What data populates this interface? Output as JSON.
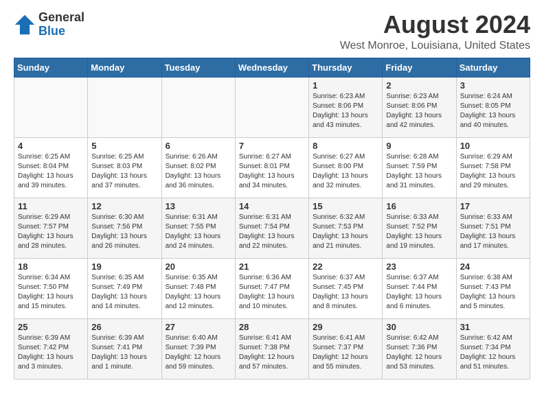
{
  "header": {
    "logo_line1": "General",
    "logo_line2": "Blue",
    "main_title": "August 2024",
    "subtitle": "West Monroe, Louisiana, United States"
  },
  "calendar": {
    "days_of_week": [
      "Sunday",
      "Monday",
      "Tuesday",
      "Wednesday",
      "Thursday",
      "Friday",
      "Saturday"
    ],
    "weeks": [
      [
        {
          "day": "",
          "info": ""
        },
        {
          "day": "",
          "info": ""
        },
        {
          "day": "",
          "info": ""
        },
        {
          "day": "",
          "info": ""
        },
        {
          "day": "1",
          "info": "Sunrise: 6:23 AM\nSunset: 8:06 PM\nDaylight: 13 hours\nand 43 minutes."
        },
        {
          "day": "2",
          "info": "Sunrise: 6:23 AM\nSunset: 8:06 PM\nDaylight: 13 hours\nand 42 minutes."
        },
        {
          "day": "3",
          "info": "Sunrise: 6:24 AM\nSunset: 8:05 PM\nDaylight: 13 hours\nand 40 minutes."
        }
      ],
      [
        {
          "day": "4",
          "info": "Sunrise: 6:25 AM\nSunset: 8:04 PM\nDaylight: 13 hours\nand 39 minutes."
        },
        {
          "day": "5",
          "info": "Sunrise: 6:25 AM\nSunset: 8:03 PM\nDaylight: 13 hours\nand 37 minutes."
        },
        {
          "day": "6",
          "info": "Sunrise: 6:26 AM\nSunset: 8:02 PM\nDaylight: 13 hours\nand 36 minutes."
        },
        {
          "day": "7",
          "info": "Sunrise: 6:27 AM\nSunset: 8:01 PM\nDaylight: 13 hours\nand 34 minutes."
        },
        {
          "day": "8",
          "info": "Sunrise: 6:27 AM\nSunset: 8:00 PM\nDaylight: 13 hours\nand 32 minutes."
        },
        {
          "day": "9",
          "info": "Sunrise: 6:28 AM\nSunset: 7:59 PM\nDaylight: 13 hours\nand 31 minutes."
        },
        {
          "day": "10",
          "info": "Sunrise: 6:29 AM\nSunset: 7:58 PM\nDaylight: 13 hours\nand 29 minutes."
        }
      ],
      [
        {
          "day": "11",
          "info": "Sunrise: 6:29 AM\nSunset: 7:57 PM\nDaylight: 13 hours\nand 28 minutes."
        },
        {
          "day": "12",
          "info": "Sunrise: 6:30 AM\nSunset: 7:56 PM\nDaylight: 13 hours\nand 26 minutes."
        },
        {
          "day": "13",
          "info": "Sunrise: 6:31 AM\nSunset: 7:55 PM\nDaylight: 13 hours\nand 24 minutes."
        },
        {
          "day": "14",
          "info": "Sunrise: 6:31 AM\nSunset: 7:54 PM\nDaylight: 13 hours\nand 22 minutes."
        },
        {
          "day": "15",
          "info": "Sunrise: 6:32 AM\nSunset: 7:53 PM\nDaylight: 13 hours\nand 21 minutes."
        },
        {
          "day": "16",
          "info": "Sunrise: 6:33 AM\nSunset: 7:52 PM\nDaylight: 13 hours\nand 19 minutes."
        },
        {
          "day": "17",
          "info": "Sunrise: 6:33 AM\nSunset: 7:51 PM\nDaylight: 13 hours\nand 17 minutes."
        }
      ],
      [
        {
          "day": "18",
          "info": "Sunrise: 6:34 AM\nSunset: 7:50 PM\nDaylight: 13 hours\nand 15 minutes."
        },
        {
          "day": "19",
          "info": "Sunrise: 6:35 AM\nSunset: 7:49 PM\nDaylight: 13 hours\nand 14 minutes."
        },
        {
          "day": "20",
          "info": "Sunrise: 6:35 AM\nSunset: 7:48 PM\nDaylight: 13 hours\nand 12 minutes."
        },
        {
          "day": "21",
          "info": "Sunrise: 6:36 AM\nSunset: 7:47 PM\nDaylight: 13 hours\nand 10 minutes."
        },
        {
          "day": "22",
          "info": "Sunrise: 6:37 AM\nSunset: 7:45 PM\nDaylight: 13 hours\nand 8 minutes."
        },
        {
          "day": "23",
          "info": "Sunrise: 6:37 AM\nSunset: 7:44 PM\nDaylight: 13 hours\nand 6 minutes."
        },
        {
          "day": "24",
          "info": "Sunrise: 6:38 AM\nSunset: 7:43 PM\nDaylight: 13 hours\nand 5 minutes."
        }
      ],
      [
        {
          "day": "25",
          "info": "Sunrise: 6:39 AM\nSunset: 7:42 PM\nDaylight: 13 hours\nand 3 minutes."
        },
        {
          "day": "26",
          "info": "Sunrise: 6:39 AM\nSunset: 7:41 PM\nDaylight: 13 hours\nand 1 minute."
        },
        {
          "day": "27",
          "info": "Sunrise: 6:40 AM\nSunset: 7:39 PM\nDaylight: 12 hours\nand 59 minutes."
        },
        {
          "day": "28",
          "info": "Sunrise: 6:41 AM\nSunset: 7:38 PM\nDaylight: 12 hours\nand 57 minutes."
        },
        {
          "day": "29",
          "info": "Sunrise: 6:41 AM\nSunset: 7:37 PM\nDaylight: 12 hours\nand 55 minutes."
        },
        {
          "day": "30",
          "info": "Sunrise: 6:42 AM\nSunset: 7:36 PM\nDaylight: 12 hours\nand 53 minutes."
        },
        {
          "day": "31",
          "info": "Sunrise: 6:42 AM\nSunset: 7:34 PM\nDaylight: 12 hours\nand 51 minutes."
        }
      ]
    ]
  }
}
